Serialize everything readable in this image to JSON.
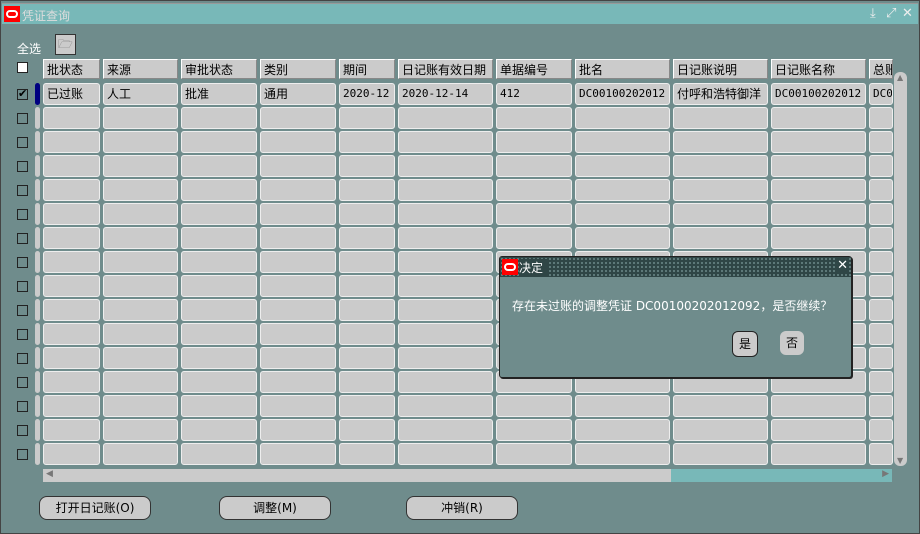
{
  "window": {
    "title": "凭证查询",
    "controls": [
      "minimize-icon",
      "maximize-icon",
      "close-icon"
    ]
  },
  "select_all_label": "全选",
  "columns": [
    "批状态",
    "来源",
    "审批状态",
    "类别",
    "期间",
    "日记账有效日期",
    "单据编号",
    "批名",
    "日记账说明",
    "日记账名称",
    "总账"
  ],
  "rows": [
    {
      "checked": true,
      "values": [
        "已过账",
        "人工",
        "批准",
        "通用",
        "2020-12",
        "2020-12-14",
        "412",
        "DC00100202012",
        "付呼和浩特御洋",
        "DC00100202012",
        "DC0"
      ]
    }
  ],
  "buttons": {
    "open_journal": "打开日记账(O)",
    "adjust": "调整(M)",
    "reverse": "冲销(R)"
  },
  "dialog": {
    "title": "决定",
    "message": "存在未过账的调整凭证 DC00100202012092，是否继续？",
    "yes": "是",
    "no": "否"
  },
  "scroll": {
    "horizontal_thumb_fraction": 0.74
  },
  "colors": {
    "titlebar": "#78b8b8",
    "background": "#6f8c8c",
    "cell": "#cbcbcb",
    "dialog_title": "#2f4646",
    "current_row_marker": "#000080"
  }
}
